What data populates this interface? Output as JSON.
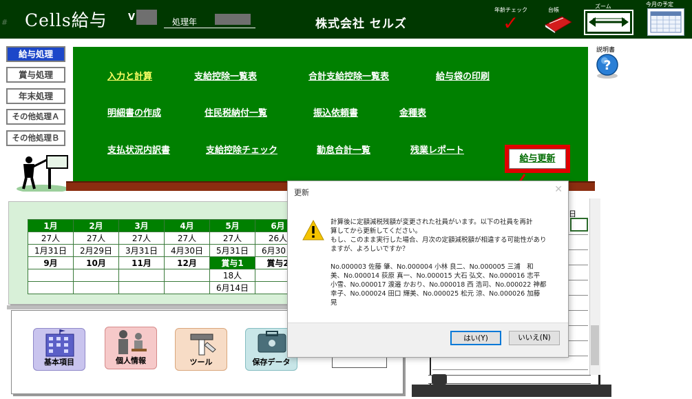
{
  "header": {
    "app_title": "Cells給与",
    "version_prefix": "V",
    "year_label": "処理年",
    "company": "株式会社 セルズ",
    "age_check_label": "年齢チェック",
    "ledger_label": "台帳",
    "zoom_label": "ズーム",
    "schedule_label": "今月の予定"
  },
  "sidebar": {
    "items": [
      {
        "label": "給与処理",
        "active": true
      },
      {
        "label": "賞与処理"
      },
      {
        "label": "年末処理"
      },
      {
        "label": "その他処理Ａ"
      },
      {
        "label": "その他処理Ｂ"
      }
    ]
  },
  "menu": {
    "links": [
      "入力と計算",
      "支給控除一覧表",
      "合計支給控除一覧表",
      "給与袋の印刷",
      "明細書の作成",
      "住民税納付一覧",
      "振込依頼書",
      "金種表",
      "支払状況内訳書",
      "支給控除チェック",
      "勤怠合計一覧",
      "残業レポート"
    ],
    "update_button": "給与更新"
  },
  "help": {
    "label": "説明書"
  },
  "schedule": {
    "row1": [
      "1月",
      "2月",
      "3月",
      "4月",
      "5月",
      "6月"
    ],
    "row2": [
      "27人",
      "27人",
      "27人",
      "27人",
      "27人",
      "26人"
    ],
    "row3": [
      "1月31日",
      "2月29日",
      "3月31日",
      "4月30日",
      "5月31日",
      "6月30日"
    ],
    "row4": [
      "9月",
      "10月",
      "11月",
      "12月",
      "賞与1",
      "賞与2"
    ],
    "row5": [
      "",
      "",
      "",
      "",
      "18人",
      ""
    ],
    "row6": [
      "",
      "",
      "",
      "",
      "6月14日",
      ""
    ]
  },
  "bottom": {
    "buttons": [
      "基本項目",
      "個人情報",
      "ツール",
      "保存データ"
    ]
  },
  "right_panel": {
    "cell_text": "日"
  },
  "dialog": {
    "title": "更新",
    "message_lines": [
      "計算後に定額減税残額が変更された社員がいます。以下の社員を再計",
      "算してから更新してください。",
      "もし、このまま実行した場合、月次の定額減税額が相違する可能性があり",
      "ますが、よろしいですか？"
    ],
    "list_lines": [
      "No.000003 佐藤 肇、No.000004 小林 良二、No.000005 三浦　和",
      "美、No.000014 荻原 真一、No.000015 大石 弘文、No.000016 志平",
      "小雪、No.000017 渡邉 かおり、No.000018 西 浩司、No.000022 神都",
      "幸子、No.000024 田口 輝美、No.000025 松元 涼、No.000026 加藤",
      "晃"
    ],
    "yes_button": "はい(Y)",
    "no_button": "いいえ(N)"
  },
  "colors": {
    "header_bg": "#003800",
    "menu_bg": "#008000",
    "highlight_red": "#e00000",
    "active_blue": "#1c47c9"
  }
}
